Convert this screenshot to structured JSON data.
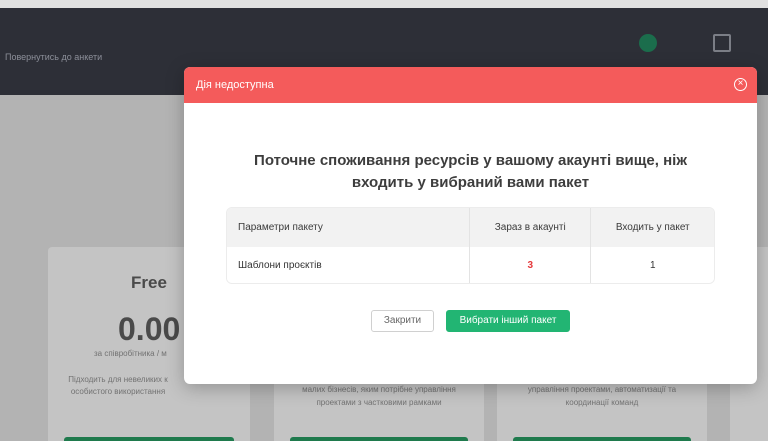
{
  "header": {
    "back_link": "Повернутись до анкети"
  },
  "plans": [
    {
      "name": "Free",
      "price": "0.00",
      "per": "за співробітника / м",
      "desc": "Підходить для невеликих к особистого використання"
    },
    {
      "desc": "малих бізнесів, яким потрібне управління проектами з частковими рамками"
    },
    {
      "desc": "управління проектами, автоматизації та координації команд"
    }
  ],
  "modal": {
    "title": "Дія недоступна",
    "heading": "Поточне споживання ресурсів у вашому акаунті вище, ніж входить у вибраний вами пакет",
    "table": {
      "headers": [
        "Параметри пакету",
        "Зараз в акаунті",
        "Входить у пакет"
      ],
      "rows": [
        {
          "param": "Шаблони проєктів",
          "current": "3",
          "included": "1"
        }
      ]
    },
    "buttons": {
      "close": "Закрити",
      "choose": "Вибрати інший пакет"
    }
  },
  "colors": {
    "modal_header": "#f45b5b",
    "primary_button": "#22b573",
    "exceeded_value": "#e5383b"
  }
}
